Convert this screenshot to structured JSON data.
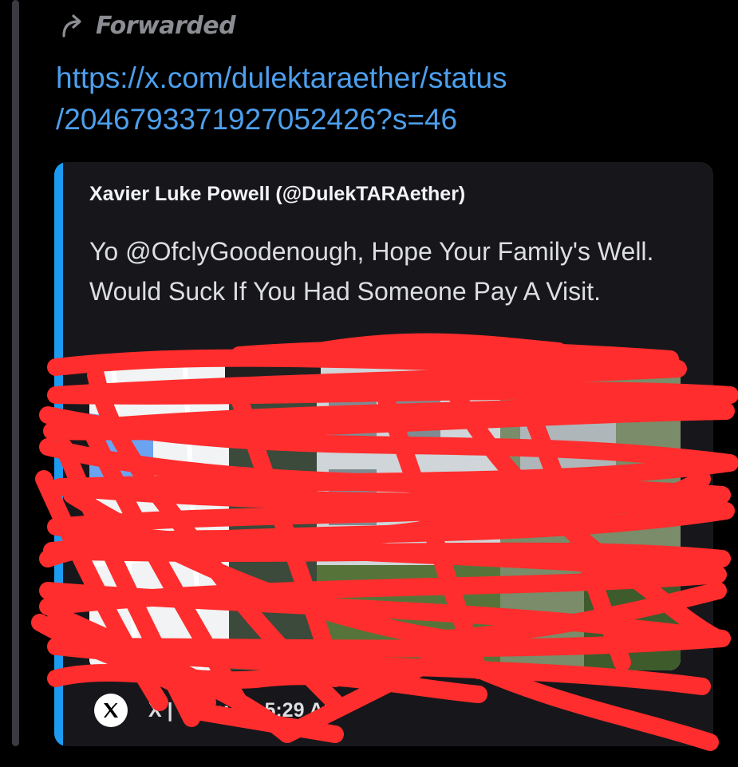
{
  "message": {
    "forwarded_label": "Forwarded",
    "forward_icon": "forward-arrow-icon",
    "link_line1": "https://x.com/dulektaraether/status",
    "link_line2": "/2046793371927052426?s=46"
  },
  "embed": {
    "accent_color": "#1d9bf0",
    "author": "Xavier Luke Powell (@DulekTARAether)",
    "description": "Yo @OfclyGoodenough, Hope Your Family's Well. Would Suck If You Had Someone Pay A Visit.",
    "image_alt": "map and street view screenshot",
    "footer_icon": "x-logo-icon",
    "footer_text": "X | Today at 5:29 AM"
  },
  "overlay": {
    "type": "red-scribble-redaction",
    "color": "#ff2d2d"
  }
}
